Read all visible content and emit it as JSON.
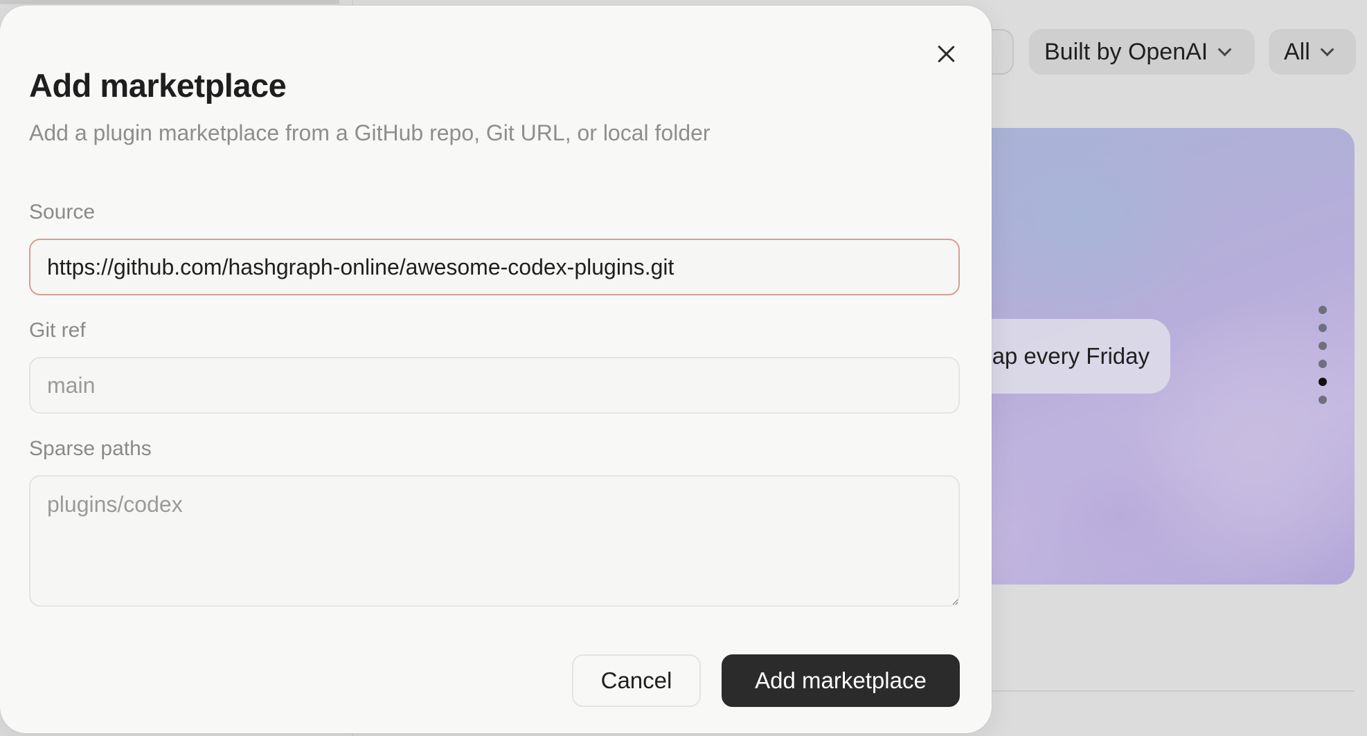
{
  "background": {
    "filters": {
      "built_by_label": "Built by OpenAI",
      "all_label": "All"
    },
    "hero": {
      "pill_text": "ap every Friday",
      "dot_count": 6,
      "active_dot_index": 4
    }
  },
  "modal": {
    "title": "Add marketplace",
    "subtitle": "Add a plugin marketplace from a GitHub repo, Git URL, or local folder",
    "source": {
      "label": "Source",
      "value": "https://github.com/hashgraph-online/awesome-codex-plugins.git"
    },
    "git_ref": {
      "label": "Git ref",
      "placeholder": "main"
    },
    "sparse_paths": {
      "label": "Sparse paths",
      "placeholder": "plugins/codex"
    },
    "buttons": {
      "cancel": "Cancel",
      "add": "Add marketplace"
    }
  },
  "colors": {
    "accent_border": "#d4a090",
    "primary_button": "#2b2b2b",
    "hero_gradient": [
      "#a9b2d6",
      "#b8aedb",
      "#c4b9e1"
    ]
  }
}
